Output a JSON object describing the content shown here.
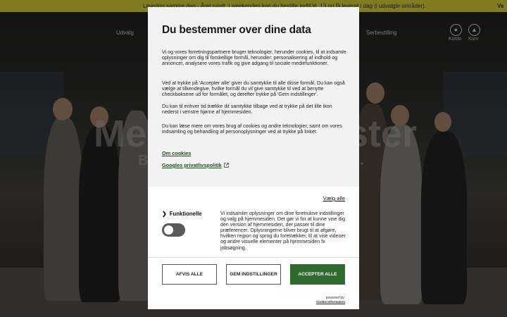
{
  "announcement": {
    "text": "Levering samme dag - Året rundt. I weekenden kan du bestille indtil kl. 13 og få leveret i dag (i udvalgte områder).",
    "trailing": "Ve"
  },
  "nav": {
    "items": [
      "Udvalg",
      "Serbestilling"
    ],
    "account_label": "Konto",
    "cart_label": "Kurv"
  },
  "hero": {
    "headline_left": "Me",
    "headline_right": "ster",
    "sub_left": "B",
    "sub_right": "e."
  },
  "consent": {
    "title": "Du bestemmer over dine data",
    "paragraphs": [
      "Vi og vores forretningspartnere bruger teknologier, herunder cookies, til at indsamle oplysninger om dig til forskellige formål, herunder: personalisering af indhold og annoncer, analysere vores trafik og give adgang til sociale mediefunktioner.",
      "Ved at trykke på 'Accepter alle' giver du samtykke til alle disse formål. Du kan også vælge at tilkendegive, hvilke formål du vil give samtykke til ved at benytte checkboksene ud for formålet, og derefter trykke på 'Gem indstillinger'.",
      "Du kan til enhver tid trække dit samtykke tilbage ved at trykke på det lille ikon nederst i venstre hjørne af hjemmesiden.",
      "Du kan læse mere om vores brug af cookies og andre teknologier, samt om vores indsamling og behandling af personoplysninger ved at trykke på linket."
    ],
    "link_cookies": "Om cookies",
    "link_google": "Googles privatlivspolitik",
    "select_all": "Vælg alle",
    "category": {
      "label": "Funktionelle",
      "enabled": false,
      "description": "Vi indsamler oplysninger om dine foretrukne indstillinger og valg på hjemmesiden. Det gør vi for at kunne vise dig den version af hjemmesiden, der passer til dine præferencer. Oplysningerne bliver brugt til at afgøre, hvilken region og sprog du foretrækker, til at vise videoer og andre visuelle elementer på hjemmesiden fx jobsøgning."
    },
    "buttons": {
      "reject": "AFVIS ALLE",
      "save": "GEM INDSTILLINGER",
      "accept": "ACCEPTER ALLE"
    },
    "powered_by": "powered by:",
    "powered_name": "Cookie Information"
  },
  "colors": {
    "announcement_bg": "#e7e43a",
    "accent_green": "#2f6b2e"
  }
}
